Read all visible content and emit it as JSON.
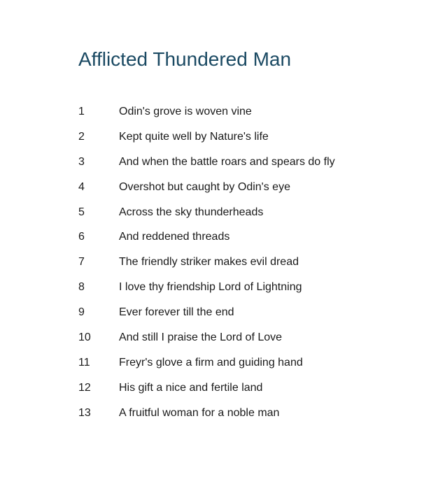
{
  "document": {
    "title": "Afflicted Thundered Man",
    "lines": [
      {
        "number": "1",
        "text": "Odin's grove is woven vine"
      },
      {
        "number": "2",
        "text": "Kept quite well by Nature's life"
      },
      {
        "number": "3",
        "text": "And when the battle roars and spears do fly"
      },
      {
        "number": "4",
        "text": "Overshot but caught by Odin's eye"
      },
      {
        "number": "5",
        "text": "Across the sky thunderheads"
      },
      {
        "number": "6",
        "text": "And reddened threads"
      },
      {
        "number": "7",
        "text": "The friendly striker makes evil dread"
      },
      {
        "number": "8",
        "text": "I love thy friendship Lord of Lightning"
      },
      {
        "number": "9",
        "text": "Ever forever till the end"
      },
      {
        "number": "10",
        "text": "And still I praise the Lord of Love"
      },
      {
        "number": "11",
        "text": "Freyr's glove a firm and guiding hand"
      },
      {
        "number": "12",
        "text": "His gift a nice and fertile land"
      },
      {
        "number": "13",
        "text": "A fruitful woman for a noble man"
      }
    ]
  },
  "colors": {
    "title": "#1b4a63",
    "body_text": "#1a1a1a",
    "background": "#ffffff"
  }
}
